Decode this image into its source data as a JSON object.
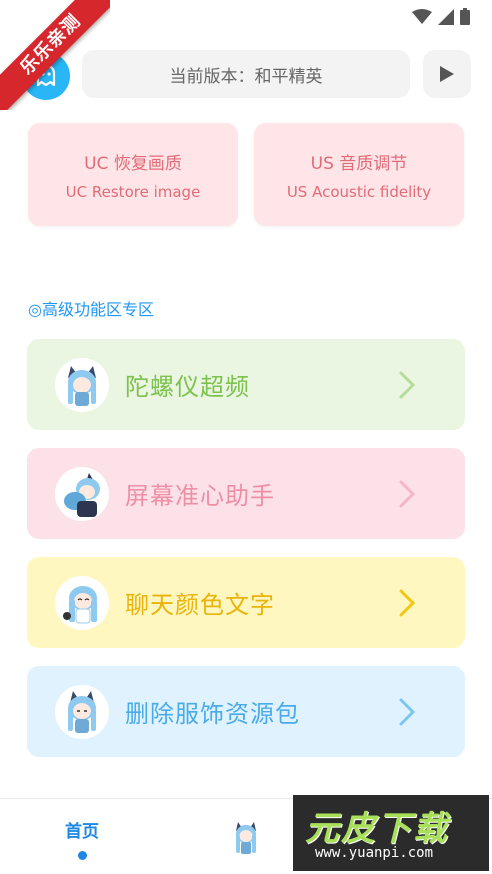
{
  "ribbon": {
    "text": "乐乐亲测"
  },
  "header": {
    "version_text": "当前版本：和平精英"
  },
  "quick_cards": [
    {
      "title": "UC 恢复画质",
      "subtitle": "UC Restore image"
    },
    {
      "title": "US 音质调节",
      "subtitle": "US Acoustic fidelity"
    }
  ],
  "section": {
    "title": "◎高级功能区专区"
  },
  "features": [
    {
      "label": "陀螺仪超频",
      "color": "#7cc24d"
    },
    {
      "label": "屏幕准心助手",
      "color": "#ee8fa6"
    },
    {
      "label": "聊天颜色文字",
      "color": "#e8b40a"
    },
    {
      "label": "删除服饰资源包",
      "color": "#4aabe8"
    }
  ],
  "bottom_nav": {
    "home_label": "首页"
  },
  "watermark": {
    "brand": "元皮下载",
    "url": "www.yuanpi.com"
  },
  "colors": {
    "accent": "#1e88e5",
    "logo": "#29b6f6",
    "ribbon": "#d6272d"
  }
}
